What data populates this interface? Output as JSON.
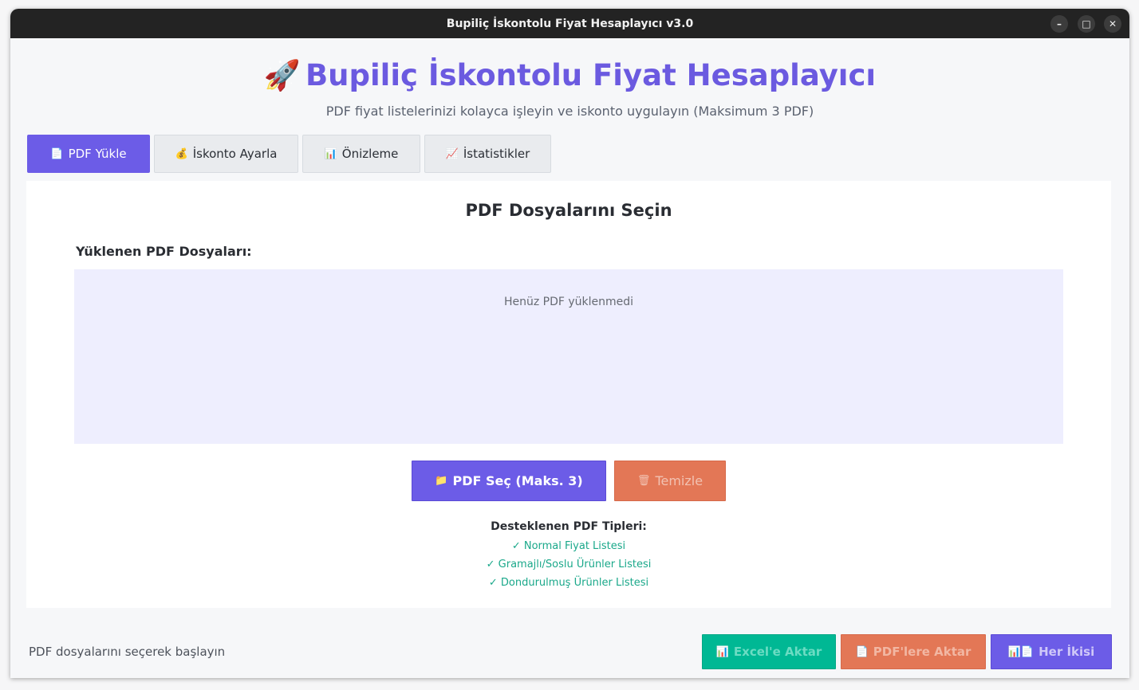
{
  "window": {
    "title": "Bupiliç İskontolu Fiyat Hesaplayıcı v3.0",
    "controls": {
      "minimize": "–",
      "maximize": "□",
      "close": "✕"
    }
  },
  "header": {
    "icon": "🚀",
    "title": "Bupiliç İskontolu Fiyat Hesaplayıcı",
    "subtitle": "PDF fiyat listelerinizi kolayca işleyin ve iskonto uygulayın (Maksimum 3 PDF)"
  },
  "tabs": [
    {
      "icon": "📄",
      "label": "PDF Yükle",
      "active": true
    },
    {
      "icon": "💰",
      "label": "İskonto Ayarla",
      "active": false
    },
    {
      "icon": "📊",
      "label": "Önizleme",
      "active": false
    },
    {
      "icon": "📈",
      "label": "İstatistikler",
      "active": false
    }
  ],
  "panel": {
    "title": "PDF Dosyalarını Seçin",
    "list_label": "Yüklenen PDF Dosyaları:",
    "empty_message": "Henüz PDF yüklenmedi",
    "select_button": {
      "icon": "📁",
      "label": "PDF Seç (Maks. 3)"
    },
    "clear_button": {
      "icon": "🗑",
      "label": "Temizle"
    },
    "supported_title": "Desteklenen PDF Tipleri:",
    "supported_types": [
      "✓ Normal Fiyat Listesi",
      "✓ Gramajlı/Soslu Ürünler Listesi",
      "✓ Dondurulmuş Ürünler Listesi"
    ]
  },
  "footer": {
    "status": "PDF dosyalarını seçerek başlayın",
    "excel_button": {
      "icon": "📊",
      "label": "Excel'e Aktar"
    },
    "pdf_button": {
      "icon": "📄",
      "label": "PDF'lere Aktar"
    },
    "both_button": {
      "icon": "📊📄",
      "label": "Her İkisi"
    }
  },
  "colors": {
    "accent": "#6c5ce7",
    "danger": "#e37756",
    "success": "#00b894"
  }
}
